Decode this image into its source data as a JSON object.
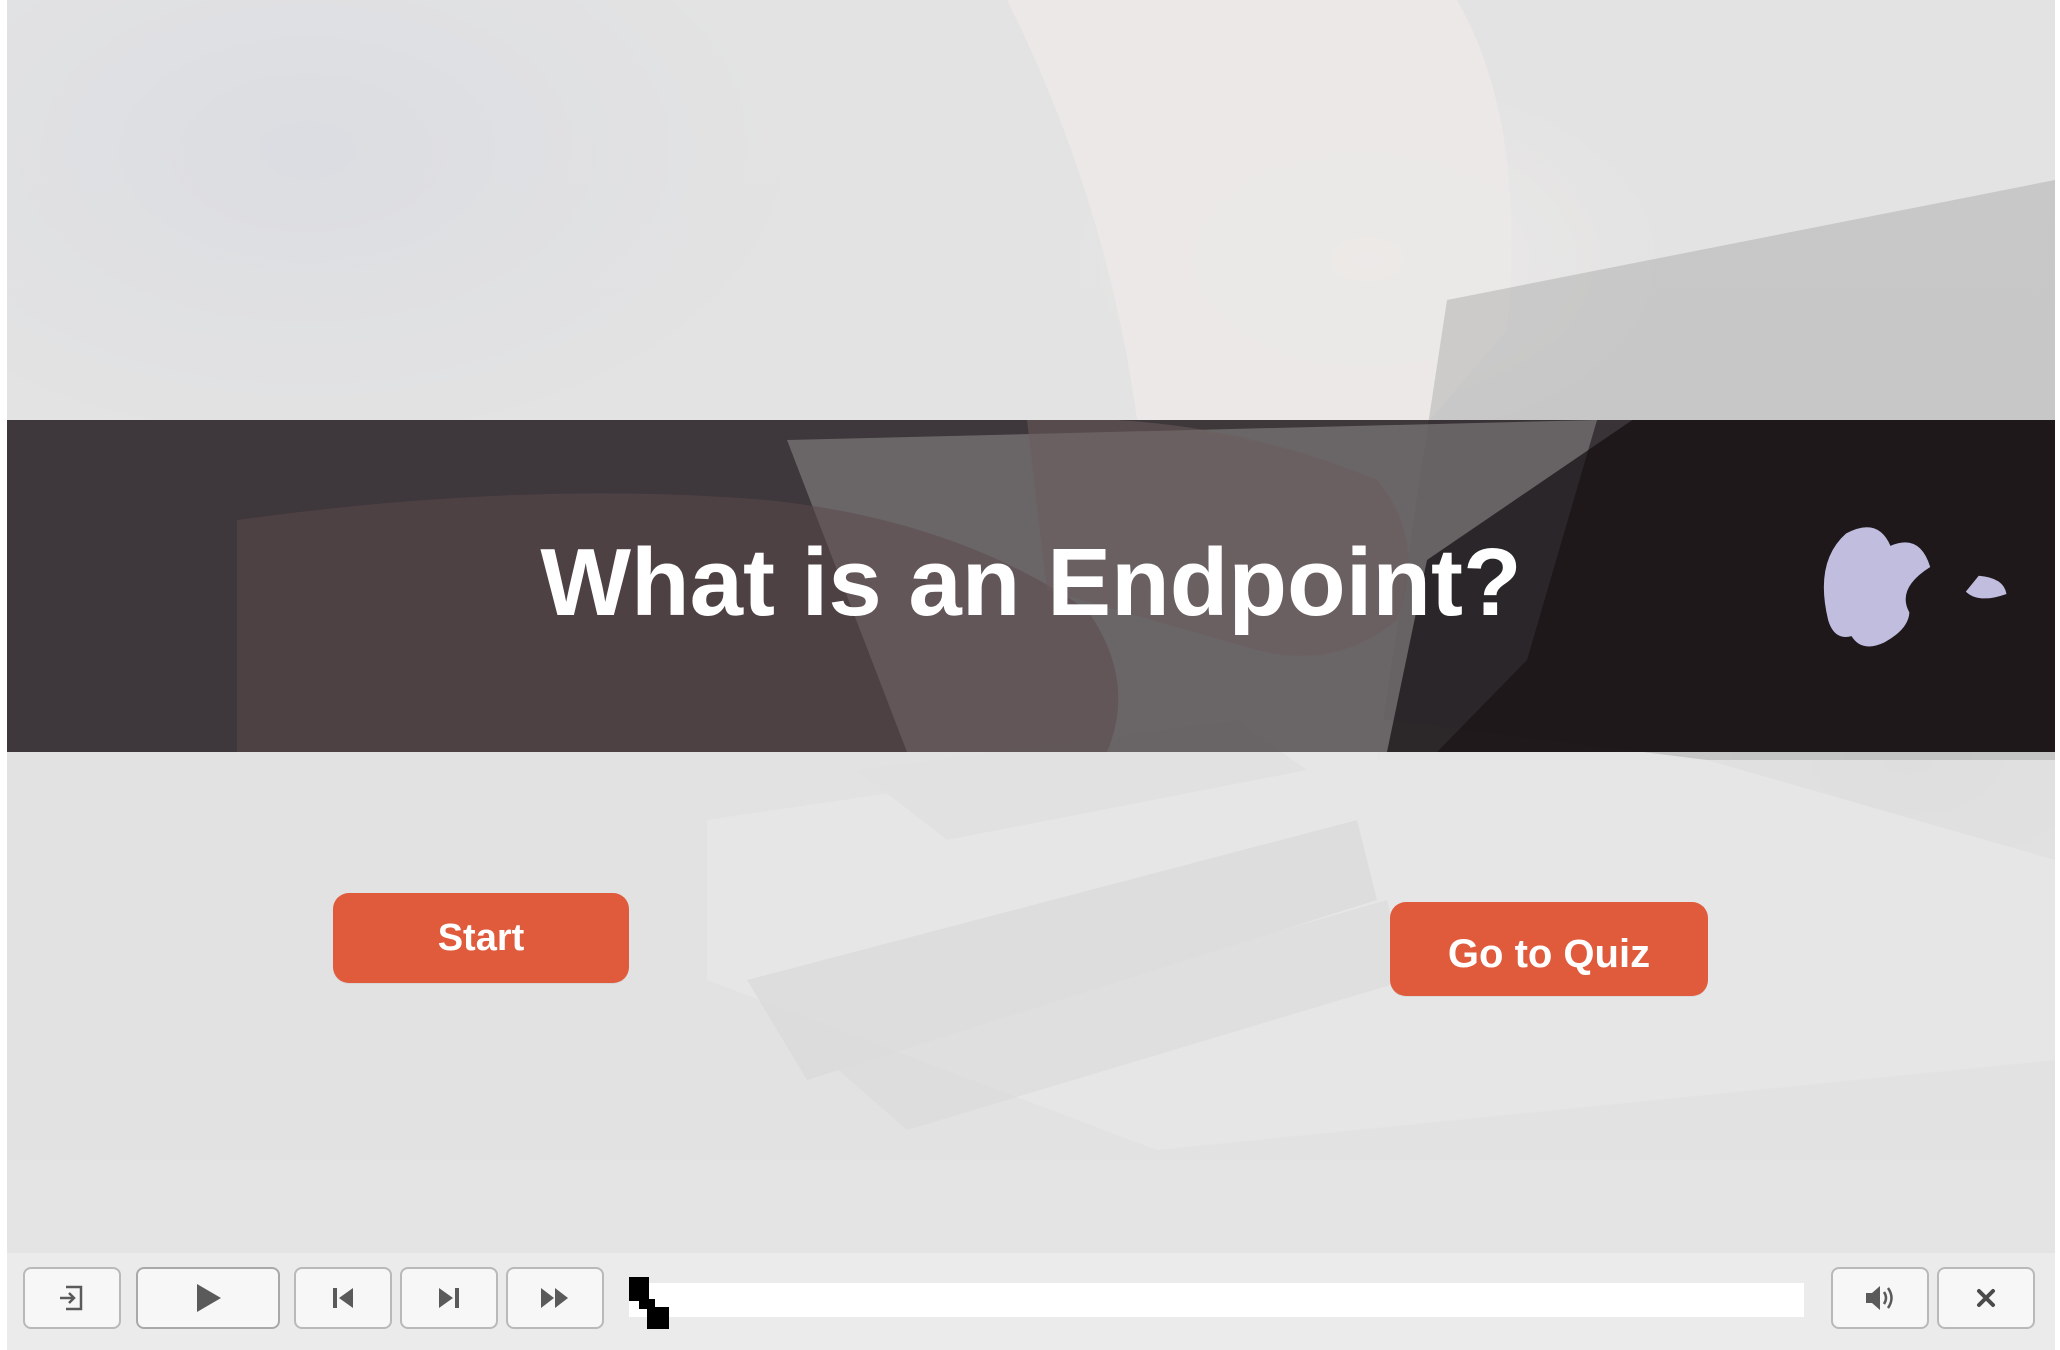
{
  "slide": {
    "title": "What is an Endpoint?",
    "start_button_label": "Start",
    "quiz_button_label": "Go to Quiz",
    "background_image": "person-typing-on-laptop-photo",
    "accent_color": "#e05b3c",
    "title_band_color": "#1e161a"
  },
  "controls": {
    "exit_icon": "exit-icon",
    "play_icon": "play-icon",
    "previous_icon": "skip-back-icon",
    "next_icon": "skip-forward-icon",
    "fast_forward_icon": "fast-forward-icon",
    "volume_icon": "volume-icon",
    "close_icon": "close-icon",
    "progress": 0
  }
}
